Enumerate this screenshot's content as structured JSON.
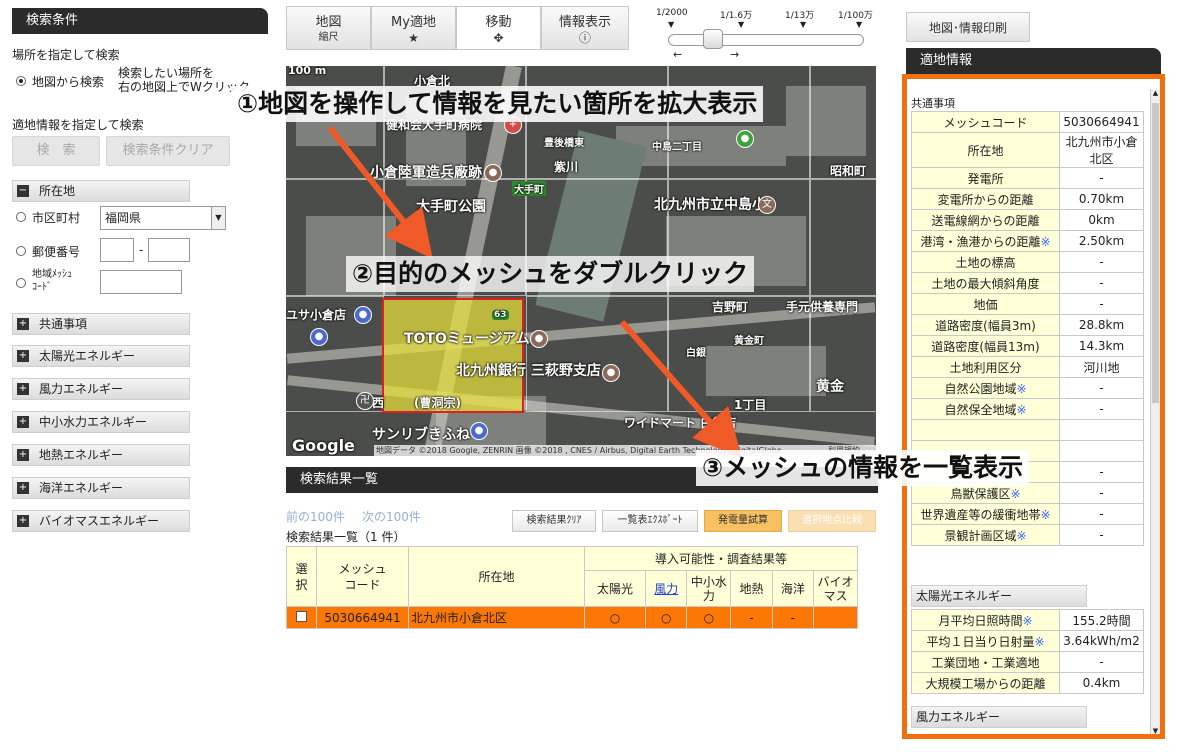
{
  "left": {
    "header": "検索条件",
    "location_search_label": "場所を指定して検索",
    "map_search_radio": "地図から検索",
    "map_search_hint_1": "検索したい場所を",
    "map_search_hint_2": "右の地図上でWクリック",
    "info_search_label": "適地情報を指定して検索",
    "search_button": "検　索",
    "clear_button": "検索条件クリア",
    "location_category": "所在地",
    "municipality_radio": "市区町村",
    "prefecture_value": "福岡県",
    "postal_radio": "郵便番号",
    "postal_sep": "-",
    "mesh_radio_1": "地域ﾒｯｼｭ",
    "mesh_radio_2": "ｺｰﾄﾞ",
    "categories": [
      "共通事項",
      "太陽光エネルギー",
      "風力エネルギー",
      "中小水力エネルギー",
      "地熱エネルギー",
      "海洋エネルギー",
      "バイオマスエネルギー"
    ]
  },
  "toolbar": {
    "map_btn": "地図",
    "map_sub": "縮尺",
    "my_site_btn": "My適地",
    "my_site_icon": "★",
    "move_btn": "移動",
    "move_icon": "✥",
    "info_btn": "情報表示",
    "info_icon": "ⓘ",
    "scales": [
      "1/2000",
      "1/1.6万",
      "1/13万",
      "1/100万"
    ],
    "print_btn": "地図･情報印刷"
  },
  "map": {
    "scale_text": "100 m",
    "labels": [
      "小倉陸軍造兵廠跡",
      "大手町公園",
      "北九州市立中島小",
      "吉野町",
      "手元供養専門",
      "TOTOミュージアム",
      "北九州銀行 三萩野支店",
      "昭和町",
      "黄金町",
      "黄金",
      "白銀",
      "1丁目",
      "ワイドマート 白銀店",
      "サンリブきふね",
      "ユサ小倉店",
      "西",
      "(曹洞宗)",
      "豊後橋東",
      "中島二丁目",
      "大手町",
      "紫川",
      "健和会大手町病院",
      "小倉北"
    ],
    "attribution": "地図データ ©2018 Google, ZENRIN 画像 ©2018 , CNES / Airbus, Digital Earth Technology, DigitalGlobe",
    "terms": "利用規約",
    "google": "Google",
    "route_badge": "63"
  },
  "results": {
    "header": "検索結果一覧",
    "prev": "前の100件",
    "next": "次の100件",
    "count": "検索結果一覧（1 件）",
    "btn_clear": "検索結果ｸﾘｱ",
    "btn_export": "一覧表ｴｸｽﾎﾟｰﾄ",
    "btn_power": "発電量試算",
    "btn_compare": "選択地点比較",
    "col_select_1": "選",
    "col_select_2": "択",
    "col_mesh_1": "メッシュ",
    "col_mesh_2": "コード",
    "col_location": "所在地",
    "col_group": "導入可能性・調査結果等",
    "col_types": [
      "太陽光",
      "風力",
      "中小水力",
      "地熱",
      "海洋",
      "バイオマス"
    ],
    "row_mesh": "5030664941",
    "row_location": "北九州市小倉北区",
    "row_values": [
      "○",
      "○",
      "○",
      "-",
      "-",
      ""
    ]
  },
  "info": {
    "header": "適地情報",
    "section_common": "共通事項",
    "rows": [
      {
        "k": "メッシュコード",
        "v": "5030664941"
      },
      {
        "k": "所在地",
        "v": "北九州市小倉北区"
      },
      {
        "k": "発電所",
        "v": "-"
      },
      {
        "k": "変電所からの距離",
        "v": "0.70km"
      },
      {
        "k": "送電線網からの距離",
        "v": "0km"
      },
      {
        "k": "港湾・漁港からの距離",
        "v": "2.50km",
        "note": "※"
      },
      {
        "k": "土地の標高",
        "v": "-"
      },
      {
        "k": "土地の最大傾斜角度",
        "v": "-"
      },
      {
        "k": "地価",
        "v": "-"
      },
      {
        "k": "道路密度(幅員3m)",
        "v": "28.8km"
      },
      {
        "k": "道路密度(幅員13m)",
        "v": "14.3km"
      },
      {
        "k": "土地利用区分",
        "v": "河川地"
      },
      {
        "k": "自然公園地域",
        "v": "-",
        "note": "※"
      },
      {
        "k": "自然保全地域",
        "v": "-",
        "note": "※"
      },
      {
        "k": "",
        "v": ""
      },
      {
        "k": "",
        "v": ""
      },
      {
        "k": "森林地域",
        "v": "-",
        "note": "※"
      },
      {
        "k": "鳥獣保護区",
        "v": "-",
        "note": "※"
      },
      {
        "k": "世界遺産等の緩衝地帯",
        "v": "-",
        "note": "※"
      },
      {
        "k": "景観計画区域",
        "v": "-",
        "note": "※"
      }
    ],
    "section_solar": "太陽光エネルギー",
    "solar_rows": [
      {
        "k": "月平均日照時間",
        "v": "155.2時間",
        "note": "※"
      },
      {
        "k": "平均１日当り日射量",
        "v": "3.64kWh/m2",
        "note": "※"
      },
      {
        "k": "工業団地・工業適地",
        "v": "-"
      },
      {
        "k": "大規模工場からの距離",
        "v": "0.4km"
      }
    ],
    "section_wind": "風力エネルギー"
  },
  "annotations": {
    "step1": "①地図を操作して情報を見たい箇所を拡大表示",
    "step2": "②目的のメッシュをダブルクリック",
    "step3": "③メッシュの情報を一覧表示"
  },
  "colors": {
    "accent_orange": "#f07010",
    "row_orange": "#fd7704",
    "header_dark": "#2b2b2b",
    "cell_yellow": "#ffffd8",
    "arrow": "#f05a28",
    "mesh_highlight": "#e9e23a"
  }
}
